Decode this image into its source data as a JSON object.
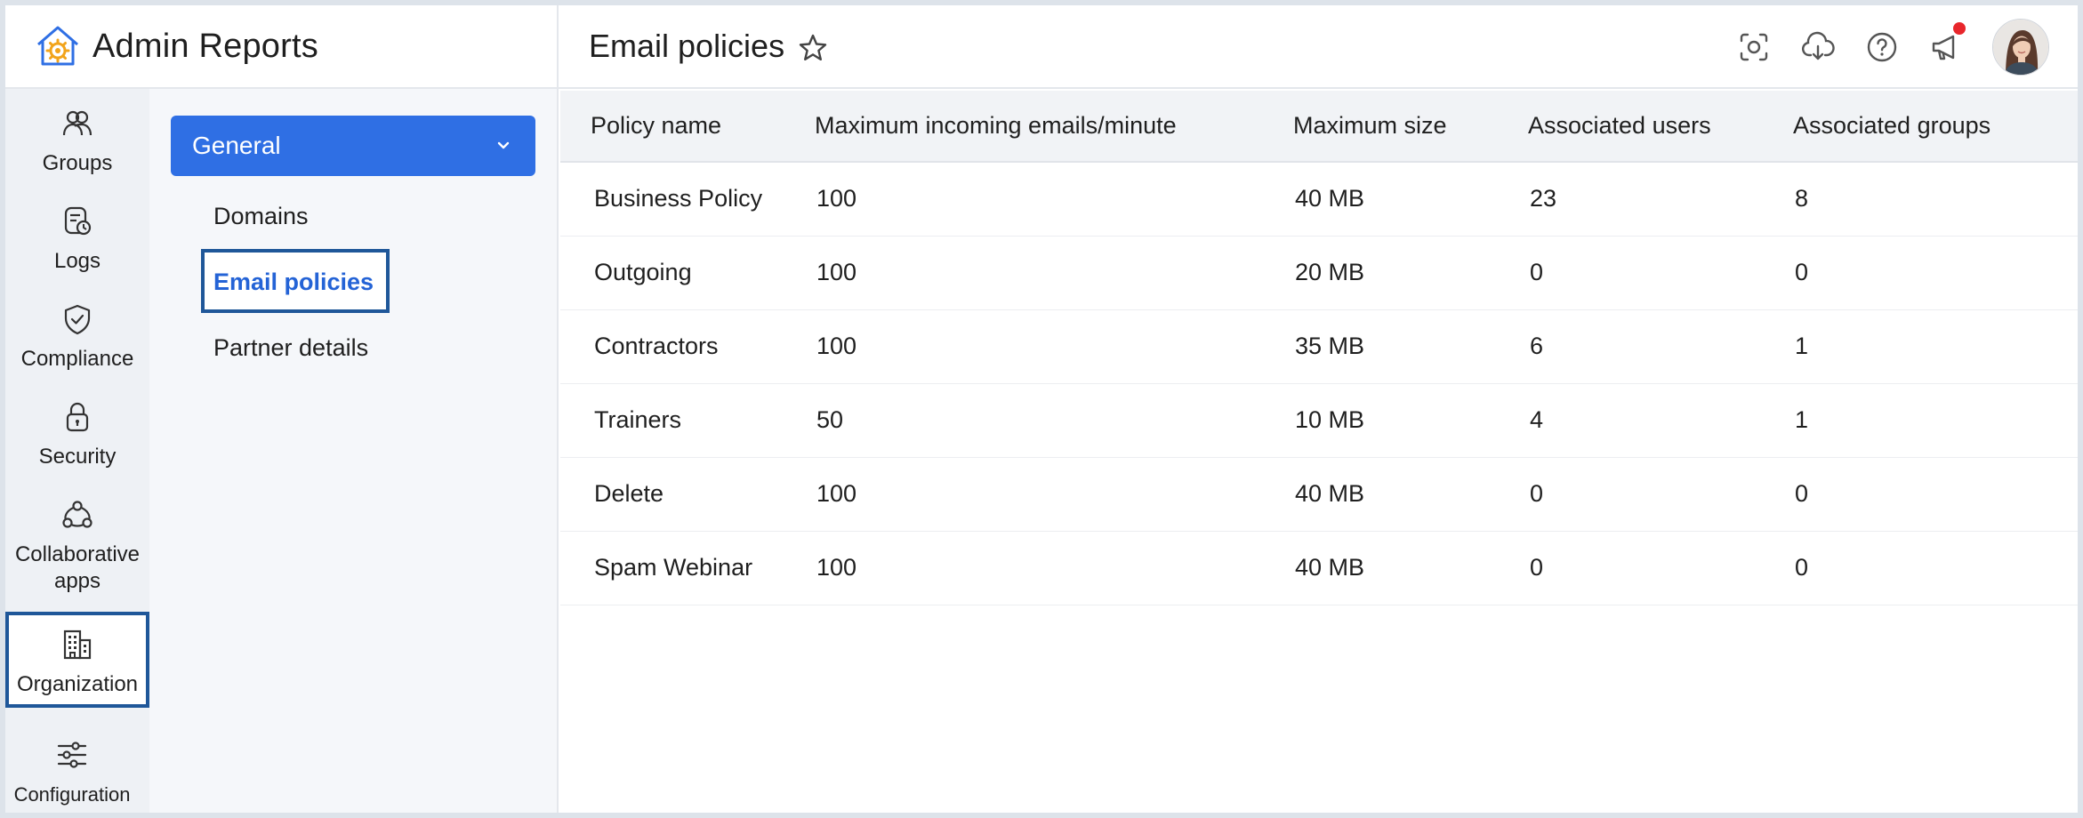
{
  "app": {
    "title": "Admin Reports"
  },
  "header": {
    "page_title": "Email policies",
    "actions": [
      "screenshot-icon",
      "cloud-download-icon",
      "help-icon",
      "announcement-icon"
    ],
    "has_notification": true
  },
  "rail": {
    "items": [
      {
        "label": "Groups",
        "icon": "groups-icon"
      },
      {
        "label": "Logs",
        "icon": "logs-icon"
      },
      {
        "label": "Compliance",
        "icon": "compliance-icon"
      },
      {
        "label": "Security",
        "icon": "lock-icon"
      },
      {
        "label": "Collaborative apps",
        "icon": "collaborative-apps-icon"
      },
      {
        "label": "Organization",
        "icon": "organization-icon",
        "active": true
      },
      {
        "label": "Configuration",
        "icon": "sliders-icon"
      }
    ]
  },
  "subnav": {
    "section": "General",
    "items": [
      {
        "label": "Domains"
      },
      {
        "label": "Email policies",
        "active": true
      },
      {
        "label": "Partner details"
      }
    ]
  },
  "table": {
    "columns": [
      "Policy name",
      "Maximum incoming emails/minute",
      "Maximum size",
      "Associated users",
      "Associated groups"
    ],
    "rows": [
      [
        "Business Policy",
        "100",
        "40 MB",
        "23",
        "8"
      ],
      [
        "Outgoing",
        "100",
        "20 MB",
        "0",
        "0"
      ],
      [
        "Contractors",
        "100",
        "35 MB",
        "6",
        "1"
      ],
      [
        "Trainers",
        "50",
        "10 MB",
        "4",
        "1"
      ],
      [
        "Delete",
        "100",
        "40 MB",
        "0",
        "0"
      ],
      [
        "Spam Webinar",
        "100",
        "40 MB",
        "0",
        "0"
      ]
    ]
  },
  "colors": {
    "accent": "#2f6fe4",
    "active_border": "#1f5799",
    "notification": "#e8262b"
  }
}
